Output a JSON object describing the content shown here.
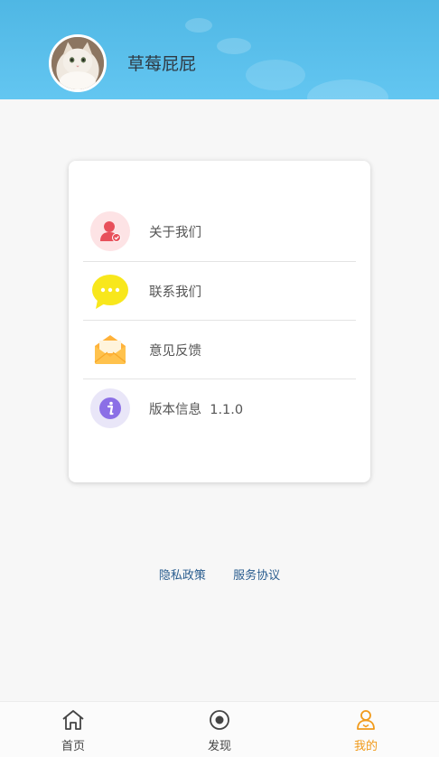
{
  "profile": {
    "username": "草莓屁屁"
  },
  "menu": {
    "items": [
      {
        "label": "关于我们",
        "icon": "person-icon",
        "icon_bg": "#fde3e5",
        "icon_color": "#e8505b"
      },
      {
        "label": "联系我们",
        "icon": "chat-bubble-icon",
        "icon_bg": "#f8e71c",
        "icon_color": "#ffffff"
      },
      {
        "label": "意见反馈",
        "icon": "envelope-icon",
        "icon_bg": "#ffb23a",
        "icon_color": "#ffffff"
      },
      {
        "label": "版本信息  1.1.0",
        "icon": "info-icon",
        "icon_bg": "#e9e6f8",
        "icon_color": "#8b6fe6"
      }
    ]
  },
  "links": {
    "privacy": "隐私政策",
    "service": "服务协议"
  },
  "tabbar": {
    "tabs": [
      {
        "label": "首页",
        "icon": "home-icon"
      },
      {
        "label": "发现",
        "icon": "discover-icon"
      },
      {
        "label": "我的",
        "icon": "profile-icon",
        "active": true
      }
    ],
    "active_color": "#f19a1a"
  }
}
